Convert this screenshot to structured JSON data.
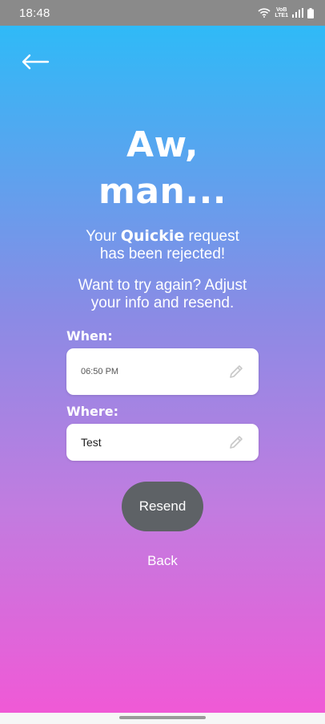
{
  "status_bar": {
    "time": "18:48",
    "icons": [
      "wifi-icon",
      "volte-lte-icon",
      "signal-icon",
      "battery-icon"
    ],
    "network_top": "VoB",
    "network_bottom": "LTE1"
  },
  "header": {
    "back_icon": "arrow-left-icon",
    "title_line1": "Aw,",
    "title_line2": "man..."
  },
  "message": {
    "line1_prefix": "Your ",
    "line1_bold": "Quickie",
    "line1_suffix": " request",
    "line2": "has been rejected!",
    "retry_line1": "Want to try again? Adjust",
    "retry_line2": "your info and resend."
  },
  "form": {
    "when_label": "When:",
    "when_value": "06:50 PM",
    "where_label": "Where:",
    "where_value": "Test",
    "edit_icon": "pencil-icon"
  },
  "actions": {
    "resend_label": "Resend",
    "back_label": "Back"
  },
  "colors": {
    "gradient_top": "#2fbaf7",
    "gradient_bottom": "#f059d6",
    "button": "#5e6266",
    "text": "#ffffff"
  }
}
